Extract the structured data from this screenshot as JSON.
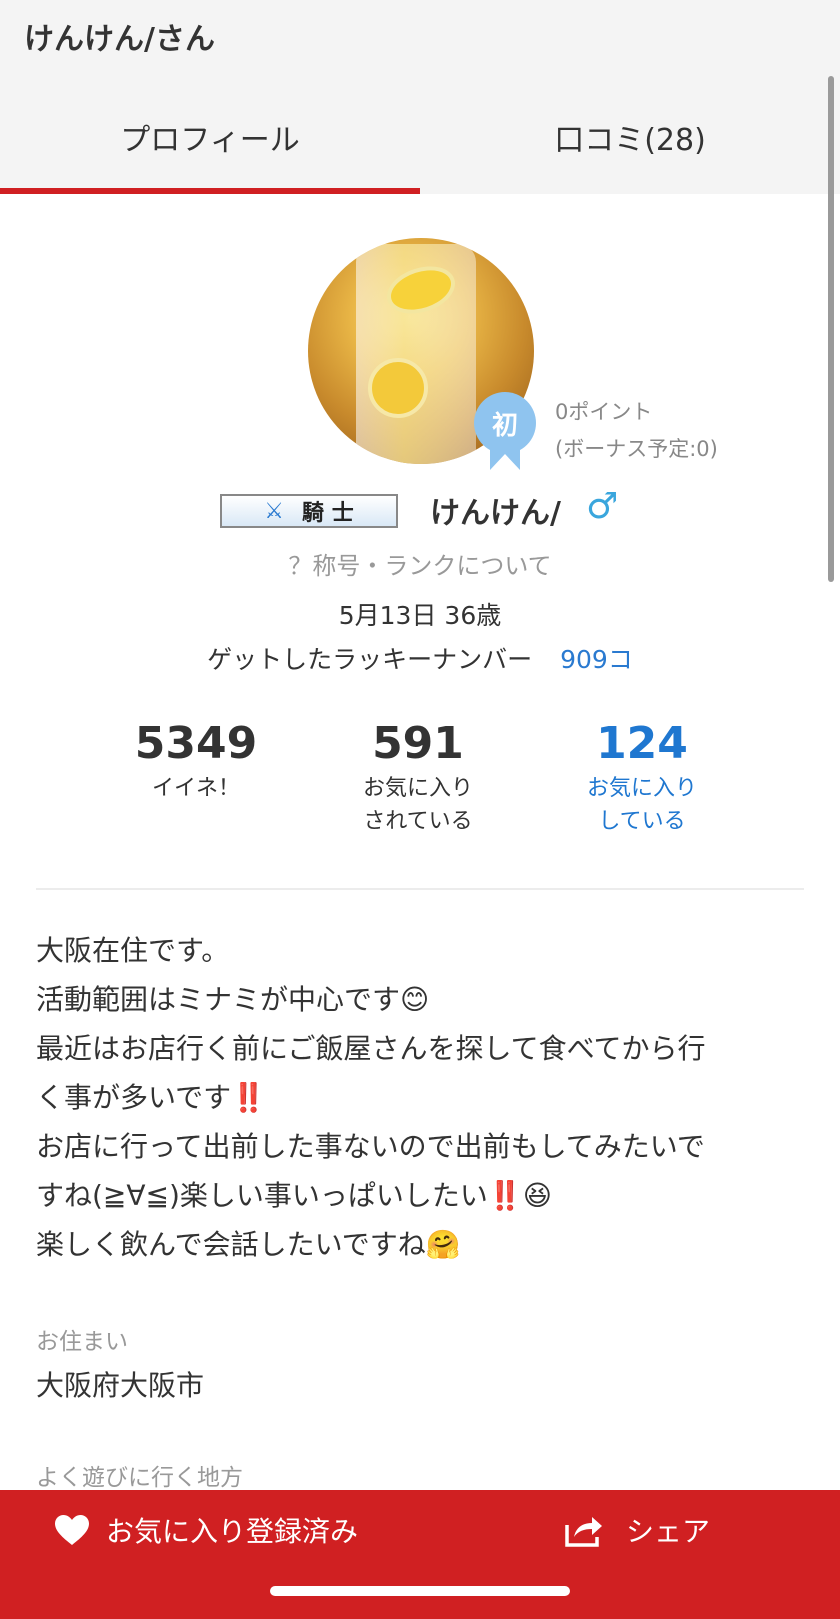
{
  "header": {
    "title": "けんけん/さん"
  },
  "tabs": [
    {
      "label": "プロフィール",
      "active": true
    },
    {
      "label": "口コミ(28)",
      "active": false
    }
  ],
  "profile": {
    "avatar_icon": "lemon-sour-photo",
    "beginner_badge": "初",
    "points": "0ポイント",
    "bonus": "(ボーナス予定:0)",
    "title_badge": {
      "icon": "crossed-swords-icon",
      "label": "騎 士"
    },
    "username": "けんけん/",
    "gender_symbol": "♂",
    "rank_link": "？称号・ランクについて",
    "birthday": "5月13日 36歳",
    "lucky_label": "ゲットしたラッキーナンバー",
    "lucky_count": "909コ"
  },
  "stats": [
    {
      "value": "5349",
      "label_line1": "イイネ！",
      "label_line2": ""
    },
    {
      "value": "591",
      "label_line1": "お気に入り",
      "label_line2": "されている"
    },
    {
      "value": "124",
      "label_line1": "お気に入り",
      "label_line2": "している"
    }
  ],
  "bio": [
    "大阪在住です。",
    "活動範囲はミナミが中心です😊",
    "最近はお店行く前にご飯屋さんを探して食べてから行",
    "く事が多いです‼️",
    "お店に行って出前した事ないので出前もしてみたいで",
    "すね(≧∀≦)楽しい事いっぱいしたい‼️😆",
    "楽しく飲んで会話したいですね🤗"
  ],
  "fields": {
    "residence_label": "お住まい",
    "residence_value": "大阪府大阪市",
    "area_label": "よく遊びに行く地方"
  },
  "bottom_bar": {
    "favorite_label": "お気に入り登録済み",
    "share_label": "シェア"
  },
  "colors": {
    "brand_red": "#d02022",
    "link_blue": "#1f77d0",
    "badge_blue": "#8fc4ef"
  }
}
